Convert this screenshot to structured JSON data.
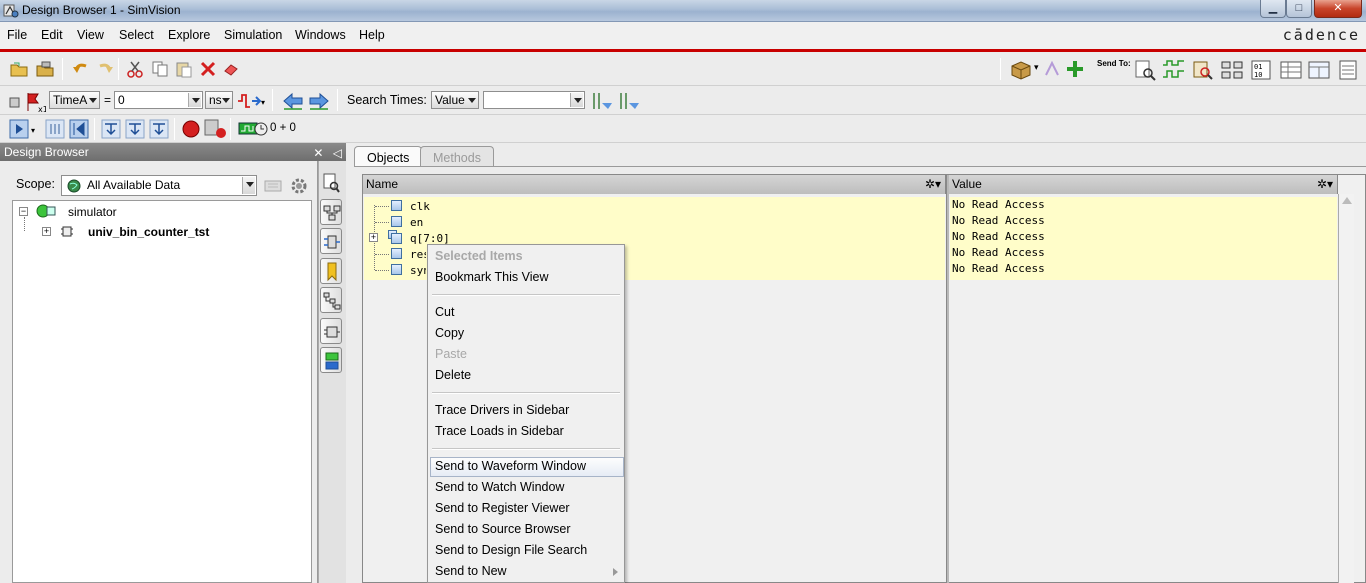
{
  "window": {
    "title": "Design Browser 1 - SimVision",
    "brand": "cādence"
  },
  "menubar": [
    "File",
    "Edit",
    "View",
    "Select",
    "Explore",
    "Simulation",
    "Windows",
    "Help"
  ],
  "toolbar1": {
    "send_to_label": "Send To:"
  },
  "toolbar2": {
    "time_unit_combo": "TimeA",
    "equals": "=",
    "time_value": "0",
    "time_units": "ns",
    "search_times_label": "Search Times:",
    "search_type": "Value",
    "search_value": ""
  },
  "toolbar3": {
    "time_readout": "0 + 0"
  },
  "left_panel": {
    "title": "Design Browser",
    "scope_label": "Scope:",
    "scope_value": "All Available Data",
    "tree": [
      {
        "label": "simulator",
        "bold": false
      },
      {
        "label": "univ_bin_counter_tst",
        "bold": true
      }
    ]
  },
  "tabs": [
    {
      "label": "Objects",
      "active": true
    },
    {
      "label": "Methods",
      "active": false
    }
  ],
  "objects": {
    "columns": [
      "Name",
      "Value"
    ],
    "rows": [
      {
        "name": "clk",
        "value": "No Read Access"
      },
      {
        "name": "en",
        "value": "No Read Access"
      },
      {
        "name": "q[7:0]",
        "value": "No Read Access"
      },
      {
        "name": "reset",
        "value": "No Read Access"
      },
      {
        "name": "syn_clr",
        "value": "No Read Access"
      }
    ]
  },
  "context_menu": {
    "header": "Selected Items",
    "items": [
      "Bookmark This View",
      "Cut",
      "Copy",
      "Paste",
      "Delete",
      "Trace Drivers in Sidebar",
      "Trace Loads in Sidebar",
      "Send to Waveform Window",
      "Send to Watch Window",
      "Send to Register Viewer",
      "Send to Source Browser",
      "Send to Design File Search",
      "Send to New"
    ]
  }
}
